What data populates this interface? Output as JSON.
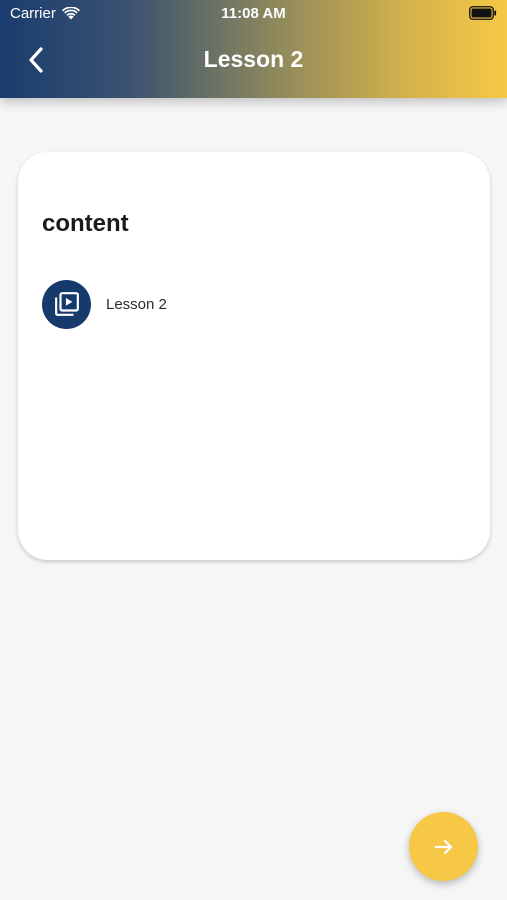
{
  "status_bar": {
    "carrier": "Carrier",
    "time": "11:08 AM",
    "icons": [
      "wifi-icon",
      "battery-icon"
    ]
  },
  "nav": {
    "title": "Lesson 2",
    "back_icon": "chevron-left-icon"
  },
  "card": {
    "heading": "content",
    "items": [
      {
        "label": "Lesson 2",
        "icon": "video-library-icon"
      }
    ]
  },
  "fab": {
    "icon": "arrow-right-icon"
  },
  "colors": {
    "primary": "#173a6c",
    "accent": "#f7c846",
    "background": "#f6f6f7",
    "card": "#ffffff"
  }
}
